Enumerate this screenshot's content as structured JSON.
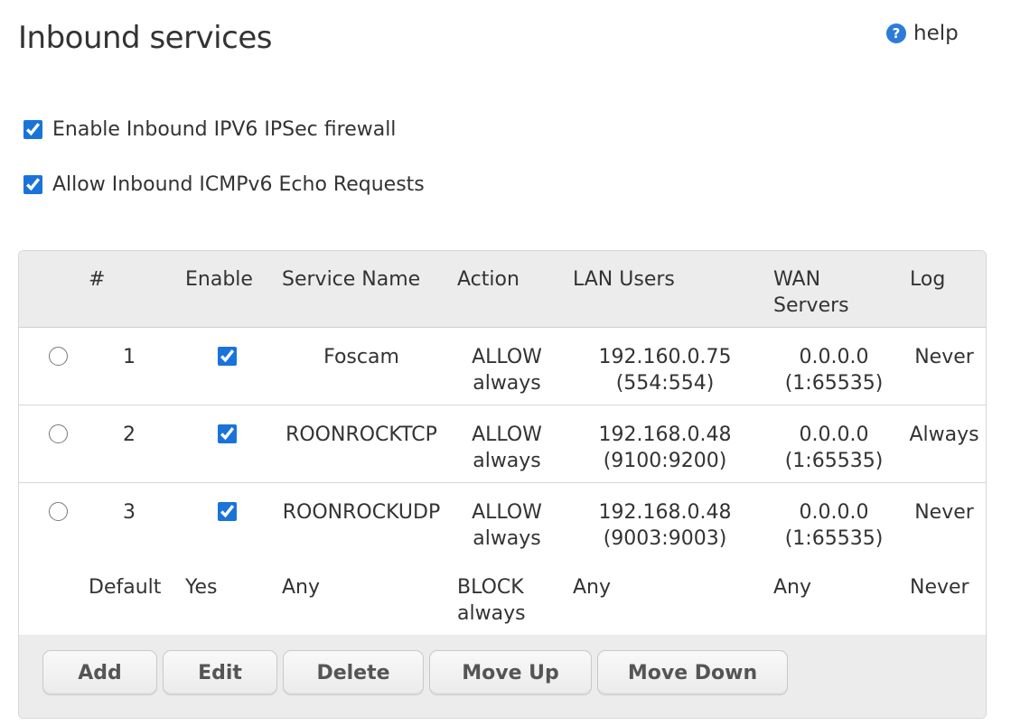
{
  "page": {
    "title": "Inbound services",
    "help_label": "help"
  },
  "options": [
    {
      "label": "Enable Inbound IPV6 IPSec firewall",
      "checked": true
    },
    {
      "label": "Allow Inbound ICMPv6 Echo Requests",
      "checked": true
    }
  ],
  "table": {
    "headers": {
      "num": "#",
      "enable": "Enable",
      "service": "Service Name",
      "action": "Action",
      "lan": "LAN Users",
      "wan": "WAN Servers",
      "log": "Log"
    },
    "rows": [
      {
        "num": "1",
        "enabled": true,
        "service": "Foscam",
        "action": "ALLOW always",
        "lan": "192.160.0.75 (554:554)",
        "wan": "0.0.0.0 (1:65535)",
        "log": "Never"
      },
      {
        "num": "2",
        "enabled": true,
        "service": "ROONROCKTCP",
        "action": "ALLOW always",
        "lan": "192.168.0.48 (9100:9200)",
        "wan": "0.0.0.0 (1:65535)",
        "log": "Always"
      },
      {
        "num": "3",
        "enabled": true,
        "service": "ROONROCKUDP",
        "action": "ALLOW always",
        "lan": "192.168.0.48 (9003:9003)",
        "wan": "0.0.0.0 (1:65535)",
        "log": "Never"
      }
    ],
    "default_row": {
      "num": "Default",
      "enable": "Yes",
      "service": "Any",
      "action": "BLOCK always",
      "lan": "Any",
      "wan": "Any",
      "log": "Never"
    }
  },
  "buttons": {
    "add": "Add",
    "edit": "Edit",
    "delete": "Delete",
    "move_up": "Move Up",
    "move_down": "Move Down"
  },
  "colors": {
    "accent": "#1a73d9",
    "header_bg": "#ececec",
    "text": "#333333"
  },
  "icons": {
    "help": "question-circle-icon"
  }
}
